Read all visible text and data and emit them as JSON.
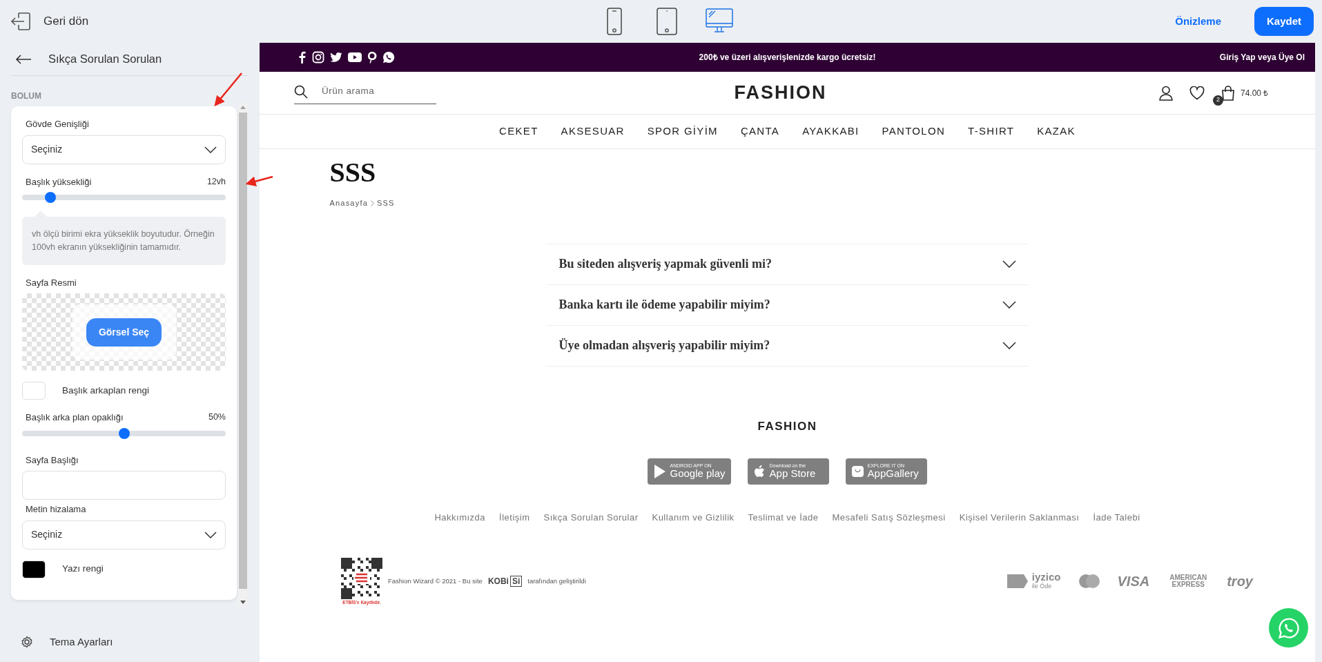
{
  "topbar": {
    "back_label": "Geri dön",
    "devices": [
      {
        "kind": "phone",
        "selected": false
      },
      {
        "kind": "tablet",
        "selected": false
      },
      {
        "kind": "desktop",
        "selected": true
      }
    ],
    "preview_link": "Önizleme",
    "save_button": "Kaydet"
  },
  "sidebar": {
    "title": "Sıkça Sorulan Sorulan",
    "section_label": "BOLUM",
    "fields": [
      {
        "kind": "select",
        "label": "Gövde Genişliği",
        "value": "Seçiniz"
      },
      {
        "kind": "slider",
        "label": "Başlık yüksekliği",
        "reading": "12vh",
        "level": 0.14
      },
      {
        "kind": "note",
        "text": "vh ölçü birimi ekra yükseklik boyutudur. Örneğin 100vh ekranın yüksekliğinin tamamıdır."
      },
      {
        "kind": "image",
        "label": "Sayfa Resmi",
        "button": "Görsel Seç"
      },
      {
        "kind": "color",
        "label": "Başlık arkaplan rengi",
        "color": "#ffffff"
      },
      {
        "kind": "slider",
        "label": "Başlık arka plan opaklığı",
        "reading": "50%",
        "level": 0.5
      },
      {
        "kind": "text",
        "label": "Sayfa Başlığı"
      },
      {
        "kind": "select",
        "label": "Metin hizalama",
        "value": "Seçiniz"
      },
      {
        "kind": "color",
        "label": "Yazı rengi",
        "color": "#000000"
      }
    ],
    "footer_item": "Tema Ayarları"
  },
  "preview": {
    "announcement": "200₺ ve üzeri alışverişlenizde kargo ücretsiz!",
    "login_link": "Giriş Yap veya Üye Ol",
    "search": {
      "placeholder": "Ürün arama"
    },
    "logo": "FASHION",
    "cart_count": "2",
    "cart_total": "74.00 ₺",
    "nav": [
      "CEKET",
      "AKSESUAR",
      "SPOR GİYİM",
      "ÇANTA",
      "AYAKKABI",
      "PANTOLON",
      "T-SHIRT",
      "KAZAK"
    ],
    "page_title": "SSS",
    "breadcrumb": [
      "Anasayfa",
      "SSS"
    ],
    "faq": [
      {
        "question": "Bu siteden alışveriş yapmak güvenli mi?",
        "expanded": false
      },
      {
        "question": "Banka kartı ile ödeme yapabilir miyim?",
        "expanded": false
      },
      {
        "question": "Üye olmadan alışveriş yapabilir miyim?",
        "expanded": false
      }
    ],
    "footer": {
      "logo": "FASHION",
      "apps": [
        {
          "kind": "google",
          "small": "ANDROID APP ON",
          "big": "Google play"
        },
        {
          "kind": "apple",
          "small": "Download on the",
          "big": "App Store"
        },
        {
          "kind": "huawei",
          "small": "EXPLORE IT ON",
          "big": "AppGallery"
        }
      ],
      "links": [
        "Hakkımızda",
        "İletişim",
        "Sıkça Sorulan Sorular",
        "Kullanım ve Gizlilik",
        "Teslimat ve İade",
        "Mesafeli Satış Sözleşmesi",
        "Kişisel Verilerin Saklanması",
        "İade Talebi"
      ],
      "etbis": "ETBİS'e Kayıtlıdır.",
      "copyright": "Fashion Wizard © 2021 - Bu site",
      "builder_logo": [
        "KOBi",
        "Si"
      ],
      "builder_suffix": "tarafından geliştirildi",
      "payments": [
        {
          "kind": "iyzico",
          "text": "iyzico",
          "subtitle": "ile Öde"
        },
        {
          "kind": "mastercard"
        },
        {
          "kind": "wordmark",
          "text": "VISA"
        },
        {
          "kind": "wordmark",
          "text": "AMERICAN EXPRESS"
        },
        {
          "kind": "wordmark",
          "text": "troy"
        }
      ]
    }
  }
}
